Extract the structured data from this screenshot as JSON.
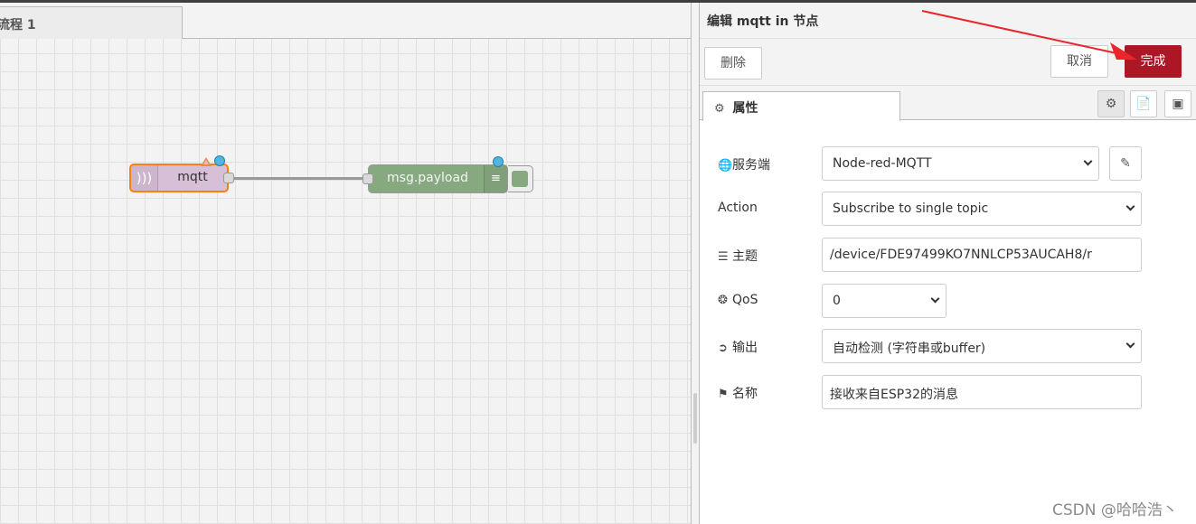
{
  "workspace": {
    "tab_label": "流程 1",
    "nodes": {
      "mqtt_in": {
        "label": "mqtt",
        "icon": "bridge-icon"
      },
      "debug": {
        "label": "msg.payload",
        "icon": "list-icon"
      }
    }
  },
  "tray": {
    "title": "编辑 mqtt in 节点",
    "buttons": {
      "delete": "删除",
      "cancel": "取消",
      "done": "完成"
    },
    "tabs": {
      "properties": "属性"
    },
    "fields": {
      "server": {
        "label": "服务端",
        "value": "Node-red-MQTT"
      },
      "action": {
        "label": "Action",
        "value": "Subscribe to single topic"
      },
      "topic": {
        "label": "主题",
        "value": "/device/FDE97499KO7NNLCP53AUCAH8/r"
      },
      "qos": {
        "label": "QoS",
        "value": "0"
      },
      "output": {
        "label": "输出",
        "value": "自动检测 (字符串或buffer)"
      },
      "name": {
        "label": "名称",
        "value": "接收来自ESP32的消息"
      }
    }
  },
  "watermark": "CSDN @哈哈浩丶",
  "colors": {
    "done_button": "#ad1625",
    "mqtt_node": "#d8bfd8",
    "debug_node": "#87a980",
    "selection_border": "#ff7f0e",
    "annotation_arrow": "#e8262b"
  }
}
